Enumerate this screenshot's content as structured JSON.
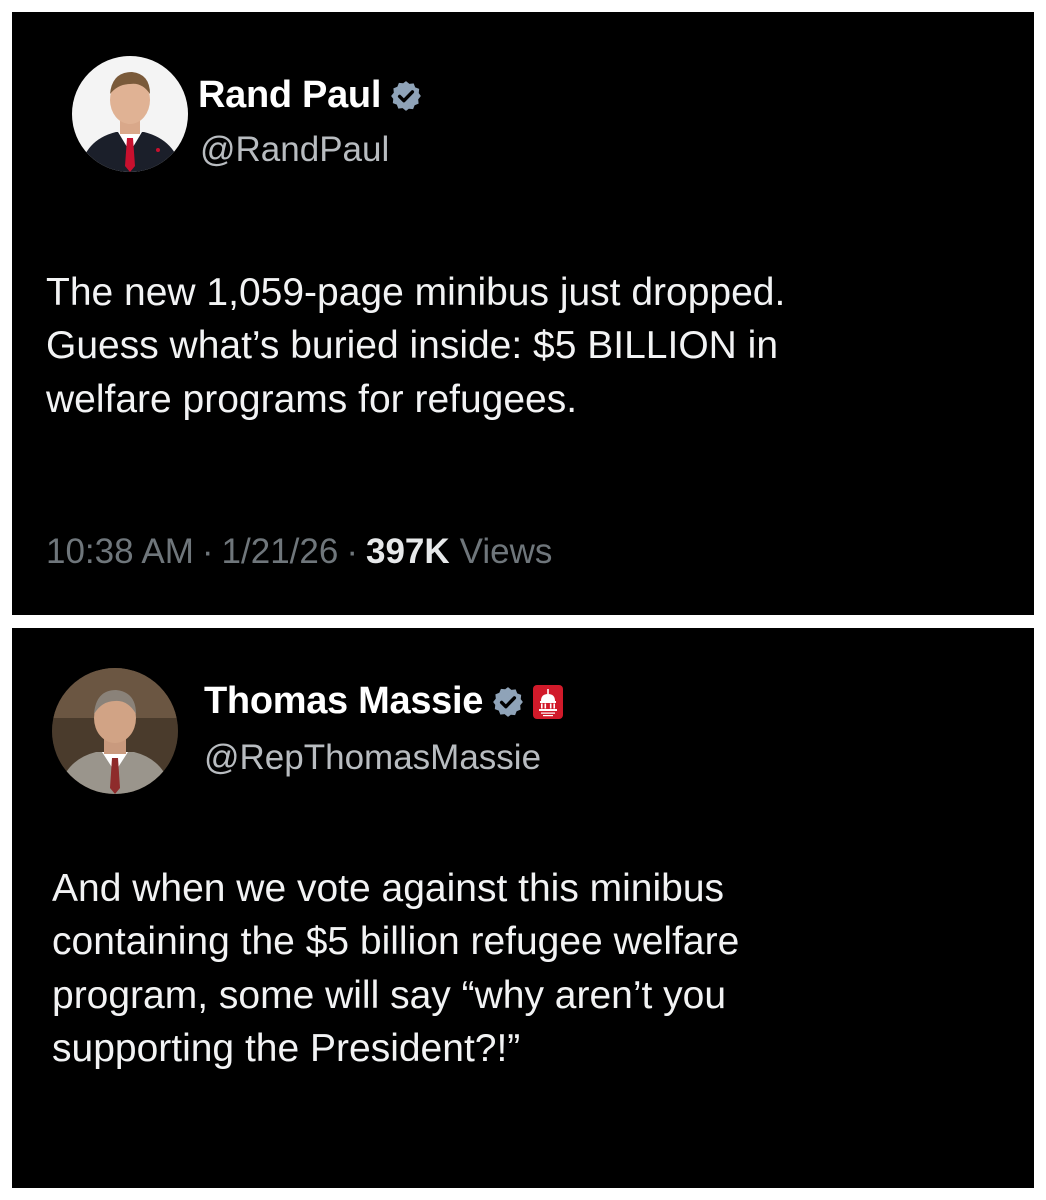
{
  "tweets": [
    {
      "author": {
        "display_name": "Rand Paul",
        "handle": "@RandPaul",
        "verified": true,
        "avatar": "rand-paul-avatar"
      },
      "text": "The new 1,059-page minibus just dropped.\nGuess what’s buried inside: $5 BILLION in\nwelfare programs for refugees.",
      "time": "10:38 AM",
      "date": "1/21/26",
      "views_count": "397K",
      "views_label": "Views"
    },
    {
      "author": {
        "display_name": "Thomas Massie",
        "handle": "@RepThomasMassie",
        "verified": true,
        "affiliation_badge": "house-gop-capitol-icon",
        "avatar": "thomas-massie-avatar"
      },
      "text": "And when we vote against this minibus\ncontaining the $5 billion refugee welfare\nprogram, some will say “why aren’t you\nsupporting the President?!”"
    }
  ],
  "colors": {
    "background": "#000000",
    "text": "#e7e9ea",
    "muted": "#6f767b",
    "verified_badge": "#8fa3b8",
    "affiliation_badge": "#d11a2a"
  }
}
